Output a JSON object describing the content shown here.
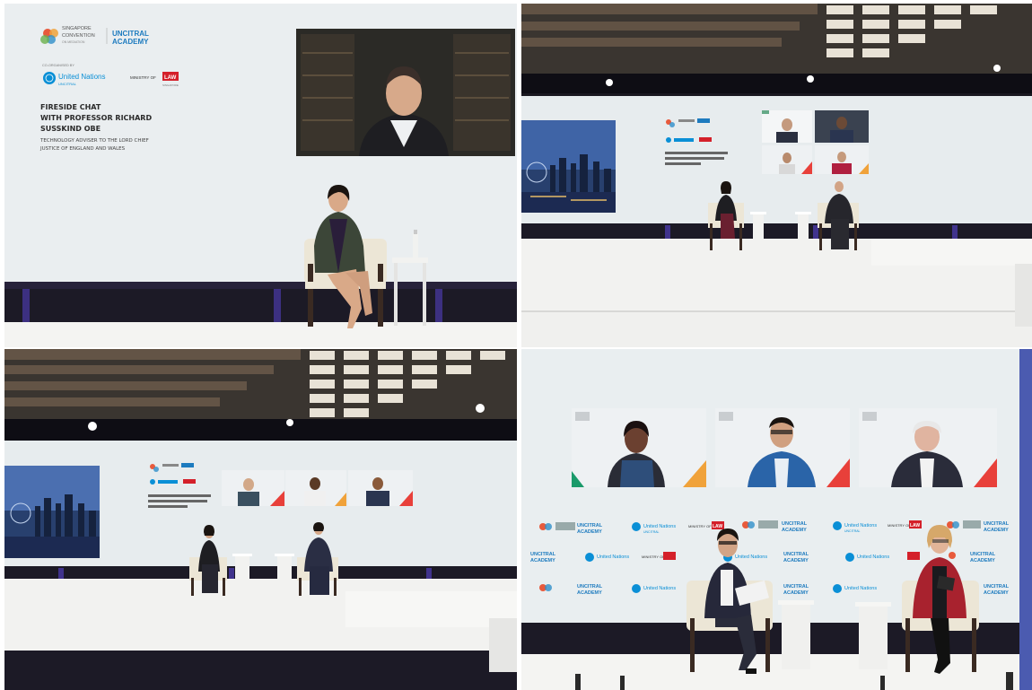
{
  "panel1": {
    "logo_top": "SINGAPORE",
    "logo_mid": "CONVENTION",
    "logo_bottom": "ON MEDIATION",
    "academy_top": "UNCITRAL",
    "academy_bottom": "ACADEMY",
    "co_organised": "CO-ORGANISED BY",
    "un_label": "United Nations",
    "un_sub": "UNCITRAL",
    "ministry_label": "MINISTRY OF",
    "ministry_law": "LAW",
    "ministry_sub": "SINGAPORE",
    "title_line1": "FIRESIDE CHAT",
    "title_line2": "WITH PROFESSOR RICHARD",
    "title_line3": "SUSSKIND OBE",
    "subtitle_line1": "TECHNOLOGY ADVISER TO THE LORD CHIEF",
    "subtitle_line2": "JUSTICE OF ENGLAND AND WALES"
  },
  "panel4": {
    "un_label": "United Nations",
    "un_sub": "UNCITRAL",
    "academy_top": "UNCITRAL",
    "academy_bottom": "ACADEMY",
    "ministry_label": "MINISTRY OF",
    "ministry_law": "LAW"
  },
  "colors": {
    "stage_white": "#f4f4f2",
    "screen_white": "#e9eef0",
    "un_blue": "#0a8fd6",
    "academy_blue": "#1d7bbf",
    "law_red": "#d4202a",
    "stage_floor": "#1c1a26",
    "chair_cream": "#ece6d6"
  }
}
